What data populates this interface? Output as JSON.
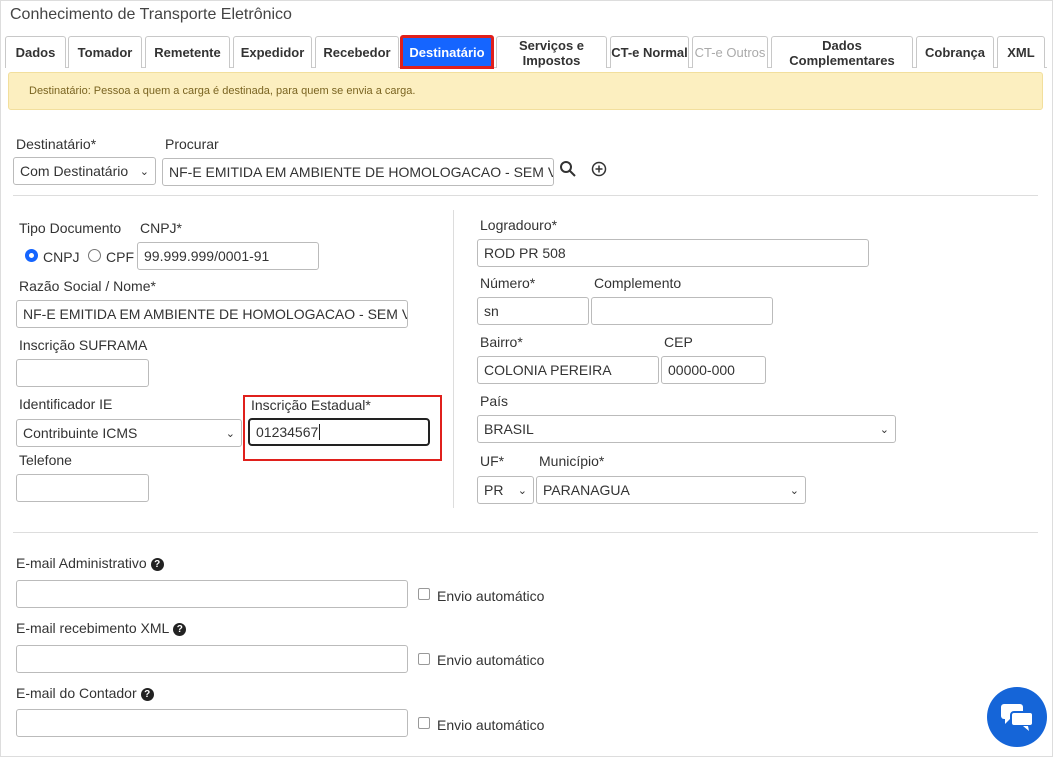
{
  "window": {
    "title": "Conhecimento de Transporte Eletrônico"
  },
  "tabs": [
    {
      "label": "Dados"
    },
    {
      "label": "Tomador"
    },
    {
      "label": "Remetente"
    },
    {
      "label": "Expedidor"
    },
    {
      "label": "Recebedor"
    },
    {
      "label": "Destinatário"
    },
    {
      "label": "Serviços e Impostos"
    },
    {
      "label": "CT-e Normal"
    },
    {
      "label": "CT-e Outros"
    },
    {
      "label": "Dados Complementares"
    },
    {
      "label": "Cobrança"
    },
    {
      "label": "XML"
    }
  ],
  "active_tab": "Destinatário",
  "alert": {
    "text": "Destinatário: Pessoa a quem a carga é destinada, para quem se envia a carga."
  },
  "top": {
    "destinatario_label": "Destinatário*",
    "destinatario_value": "Com Destinatário",
    "procurar_label": "Procurar",
    "procurar_value": "NF-E EMITIDA EM AMBIENTE DE HOMOLOGACAO - SEM VALOR FISCAL"
  },
  "left": {
    "tipo_documento_label": "Tipo Documento",
    "cnpj_label": "CNPJ*",
    "radio_cnpj": "CNPJ",
    "radio_cpf": "CPF",
    "cnpj_value": "99.999.999/0001-91",
    "razao_label": "Razão Social / Nome*",
    "razao_value": "NF-E EMITIDA EM AMBIENTE DE HOMOLOGACAO - SEM VALOR FISCAL",
    "suframa_label": "Inscrição SUFRAMA",
    "suframa_value": "",
    "ident_ie_label": "Identificador IE",
    "ident_ie_value": "Contribuinte ICMS",
    "ie_label": "Inscrição Estadual*",
    "ie_value": "01234567",
    "telefone_label": "Telefone",
    "telefone_value": ""
  },
  "right": {
    "logradouro_label": "Logradouro*",
    "logradouro_value": "ROD PR 508",
    "numero_label": "Número*",
    "numero_value": "sn",
    "complemento_label": "Complemento",
    "complemento_value": "",
    "bairro_label": "Bairro*",
    "bairro_value": "COLONIA PEREIRA",
    "cep_label": "CEP",
    "cep_value": "00000-000",
    "pais_label": "País",
    "pais_value": "BRASIL",
    "uf_label": "UF*",
    "uf_value": "PR",
    "municipio_label": "Município*",
    "municipio_value": "PARANAGUA"
  },
  "emails": [
    {
      "label": "E-mail Administrativo",
      "value": "",
      "auto_label": "Envio automático"
    },
    {
      "label": "E-mail recebimento XML",
      "value": "",
      "auto_label": "Envio automático"
    },
    {
      "label": "E-mail do Contador",
      "value": "",
      "auto_label": "Envio automático"
    }
  ],
  "colors": {
    "active_tab": "#1565ff",
    "highlight": "#e0201c",
    "alert_bg": "#fcefc0",
    "chat": "#1565d8"
  },
  "icons": [
    "search-icon",
    "plus-circle-icon",
    "chevron-down-icon",
    "help-icon",
    "chat-icon"
  ]
}
